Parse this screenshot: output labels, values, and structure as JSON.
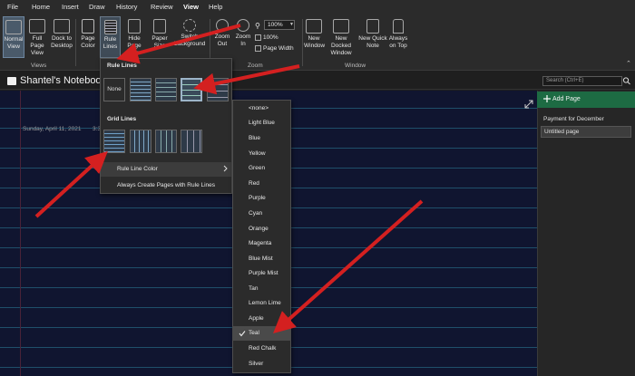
{
  "ribbon_tabs": [
    "File",
    "Home",
    "Insert",
    "Draw",
    "History",
    "Review",
    "View",
    "Help"
  ],
  "active_tab": "View",
  "buttons": {
    "normal_view": "Normal View",
    "full_page_view": "Full Page View",
    "dock_to_desktop": "Dock to Desktop",
    "page_color": "Page Color",
    "rule_lines": "Rule Lines",
    "hide_page_title": "Hide Page Title",
    "paper_size": "Paper Size",
    "switch_background": "Switch Background",
    "zoom_out": "Zoom Out",
    "zoom_in": "Zoom In",
    "new_window": "New Window",
    "new_docked_window": "New Docked Window",
    "new_quick_note": "New Quick Note",
    "always_on_top": "Always on Top"
  },
  "groups": {
    "views": "Views",
    "zoom": "Zoom",
    "window": "Window"
  },
  "zoom": {
    "value": "100%",
    "hundred": "100%",
    "page_width": "Page Width"
  },
  "notebook_title": "Shantel's Notebook",
  "search_placeholder": "Search (Ctrl+E)",
  "page": {
    "date": "Sunday, April 11, 2021",
    "time": "3:3"
  },
  "pane": {
    "add_page": "Add Page",
    "pages": [
      "Payment for December",
      "Untitled page"
    ]
  },
  "rule_lines_menu": {
    "rule_lines_header": "Rule Lines",
    "none_label": "None",
    "grid_lines_header": "Grid Lines",
    "rule_line_color": "Rule Line Color",
    "always_create": "Always Create Pages with Rule Lines"
  },
  "color_menu": {
    "items": [
      "<none>",
      "Light Blue",
      "Blue",
      "Yellow",
      "Green",
      "Red",
      "Purple",
      "Cyan",
      "Orange",
      "Magenta",
      "Blue Mist",
      "Purple Mist",
      "Tan",
      "Lemon Lime",
      "Apple",
      "Teal",
      "Red Chalk",
      "Silver"
    ],
    "selected": "Teal"
  },
  "colors": {
    "accent_green": "#1d6b43",
    "arrow_red": "#d42020",
    "canvas": "#101530",
    "rule": "#1f4f6a"
  }
}
